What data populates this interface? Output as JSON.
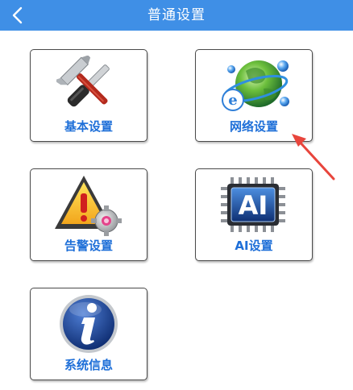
{
  "header": {
    "title": "普通设置",
    "back_icon": "chevron-left-icon",
    "bg_color": "#3f8fe6"
  },
  "tiles": [
    {
      "label": "基本设置",
      "icon": "tools-icon"
    },
    {
      "label": "网络设置",
      "icon": "network-globe-icon"
    },
    {
      "label": "告警设置",
      "icon": "alarm-warning-icon"
    },
    {
      "label": "AI设置",
      "icon": "ai-chip-icon"
    },
    {
      "label": "系统信息",
      "icon": "info-icon"
    }
  ],
  "annotation": {
    "icon": "red-pointer-arrow-icon",
    "color": "#e8453c"
  },
  "colors": {
    "label": "#1e6fd8",
    "tile_border": "#4a4a4a"
  }
}
